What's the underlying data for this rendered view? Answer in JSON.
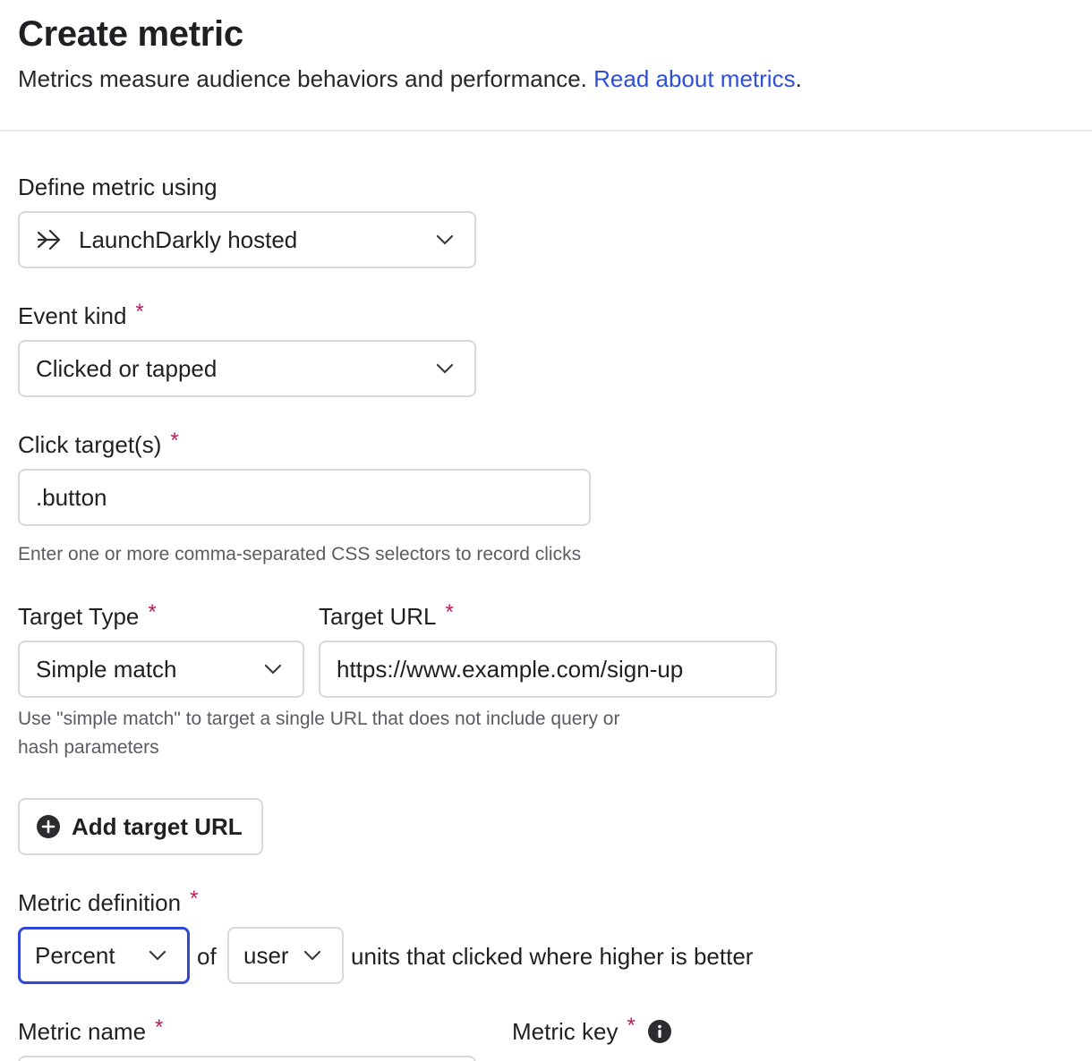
{
  "header": {
    "title": "Create metric",
    "subtitle": "Metrics measure audience behaviors and performance.",
    "link_text": "Read about metrics",
    "link_suffix": "."
  },
  "define_metric": {
    "label": "Define metric using",
    "value": "LaunchDarkly hosted",
    "icon": "arrow-right-icon"
  },
  "event_kind": {
    "label": "Event kind",
    "required": "*",
    "value": "Clicked or tapped"
  },
  "click_targets": {
    "label": "Click target(s)",
    "required": "*",
    "value": ".button",
    "help": "Enter one or more comma-separated CSS selectors to record clicks"
  },
  "target_type": {
    "label": "Target Type",
    "required": "*",
    "value": "Simple match"
  },
  "target_url": {
    "label": "Target URL",
    "required": "*",
    "value": "https://www.example.com/sign-up"
  },
  "target_help": {
    "line1": "Use \"simple match\" to target a single URL that does not include query or",
    "line2": "hash parameters"
  },
  "add_target_button": {
    "label": "Add target URL",
    "icon": "plus-circle-icon"
  },
  "metric_definition": {
    "label": "Metric definition",
    "required": "*",
    "measure": "Percent",
    "of_text": "of",
    "unit": "user",
    "suffix": "units that clicked where higher is better"
  },
  "metric_name": {
    "label": "Metric name",
    "required": "*"
  },
  "metric_key": {
    "label": "Metric key",
    "required": "*",
    "icon": "info-icon"
  },
  "colors": {
    "accent": "#2f4fd6",
    "focus_border": "#3347d6",
    "required": "#c2185b",
    "border": "#d8d9dd"
  }
}
